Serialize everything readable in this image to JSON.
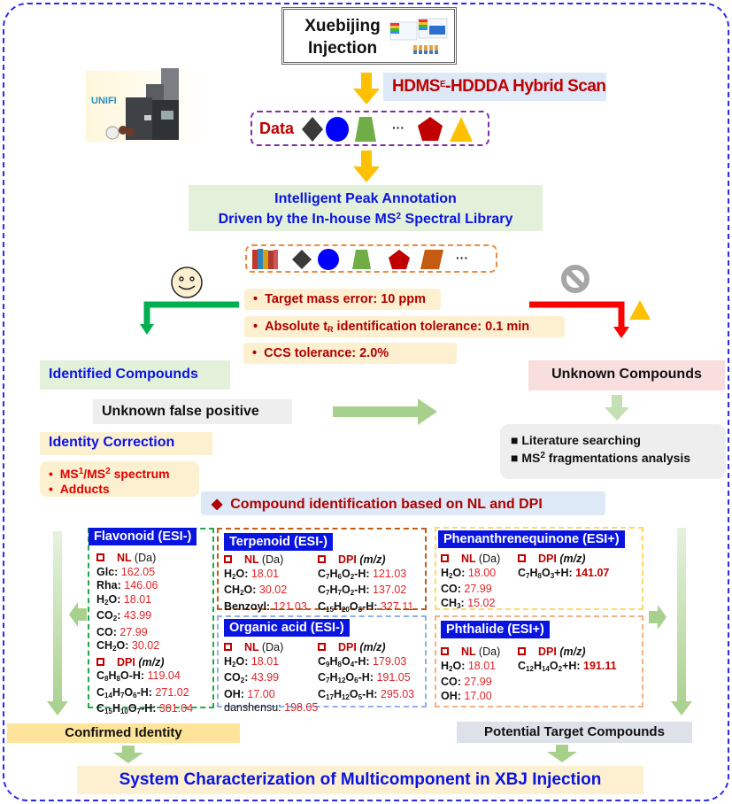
{
  "title": {
    "line1": "Xuebijing",
    "line2": "Injection",
    "image_icon": "xuebijing-package-image"
  },
  "instrument": {
    "logo_text": "UNIFI",
    "icon": "mass-spectrometer-image"
  },
  "scan": {
    "label_prefix": "HDMS",
    "label_sup": "E",
    "label_suffix": "-HDDDA Hybrid Scan"
  },
  "data_row": {
    "label": "Data",
    "ellipsis": "···",
    "shapes": [
      "diamond-dark",
      "circle-blue",
      "trapezoid-green",
      "pentagon-red",
      "triangle-yellow"
    ]
  },
  "annotation": {
    "line1": "Intelligent Peak Annotation",
    "line2_prefix": "Driven by the In-house MS",
    "line2_sup": "2",
    "line2_suffix": " Spectral Library"
  },
  "library_row": {
    "ellipsis": "···",
    "shapes": [
      "books",
      "diamond-dark",
      "circle-blue",
      "trapezoid-green",
      "pentagon-red",
      "parallelogram-orange"
    ]
  },
  "criteria": [
    {
      "bullet": "•",
      "text": "Target mass error: 10 ppm"
    },
    {
      "bullet": "•",
      "text_prefix": "Absolute t",
      "text_sub": "R",
      "text_suffix": " identification tolerance: 0.1 min"
    },
    {
      "bullet": "•",
      "text": "CCS tolerance: 2.0%"
    }
  ],
  "identified": {
    "label": "Identified Compounds",
    "status_icon": "smiley-icon"
  },
  "unknown": {
    "label": "Unknown Compounds",
    "status_icon": "no-entry-icon"
  },
  "unknown_false_positive": "Unknown false positive",
  "identity_correction": {
    "label": "Identity Correction",
    "items": [
      {
        "prefix": "MS",
        "sup1": "1",
        "mid": "/MS",
        "sup2": "2",
        "suffix": " spectrum"
      },
      {
        "text": "Adducts"
      }
    ]
  },
  "unknown_methods": [
    {
      "bullet": "■",
      "text": "Literature searching"
    },
    {
      "bullet": "■",
      "prefix": "MS",
      "sup": "2",
      "suffix": " fragmentations analysis"
    }
  ],
  "compound_id_header": {
    "bullet": "◆",
    "text": "Compound identification based on NL and DPI"
  },
  "nl_header": {
    "label": "NL",
    "unit": "(Da)"
  },
  "dpi_header": {
    "label": "DPI",
    "unit": "(m/z)"
  },
  "panels": {
    "flavonoid": {
      "title": "Flavonoid (ESI-)",
      "nl": [
        {
          "name": "Glc:",
          "value": "162.05"
        },
        {
          "name": "Rha:",
          "value": "146.06"
        },
        {
          "name": "H2O:",
          "value": "18.01"
        },
        {
          "name": "CO2:",
          "value": "43.99"
        },
        {
          "name": "CO:",
          "value": "27.99"
        },
        {
          "name": "CH2O:",
          "value": "30.02"
        }
      ],
      "dpi": [
        {
          "name": "C8H8O-H:",
          "value": "119.04"
        },
        {
          "name": "C14H7O6-H:",
          "value": "271.02"
        },
        {
          "name": "C15H10O7-H:",
          "value": "301.04"
        }
      ]
    },
    "terpenoid": {
      "title": "Terpenoid (ESI-)",
      "nl": [
        {
          "name": "H2O:",
          "value": "18.01"
        },
        {
          "name": "CH2O:",
          "value": "30.02"
        },
        {
          "name": "Benzoyl:",
          "value": "121.03"
        }
      ],
      "dpi": [
        {
          "name": "C7H6O2-H:",
          "value": "121.03"
        },
        {
          "name": "C7H7O2-H:",
          "value": "137.02"
        },
        {
          "name": "C15H20O8-H:",
          "value": "327.11"
        }
      ]
    },
    "organic_acid": {
      "title": "Organic acid (ESI-)",
      "nl": [
        {
          "name": "H2O:",
          "value": "18.01"
        },
        {
          "name": "CO2:",
          "value": "43.99"
        },
        {
          "name": "OH:",
          "value": "17.00"
        },
        {
          "name": "danshensu:",
          "value": "198.05"
        }
      ],
      "dpi": [
        {
          "name": "C9H8O4-H:",
          "value": "179.03"
        },
        {
          "name": "C7H12O6-H:",
          "value": "191.05"
        },
        {
          "name": "C17H12O5-H:",
          "value": "295.03"
        }
      ]
    },
    "phenanthrenequinone": {
      "title": "Phenanthrenequinone (ESI+)",
      "nl": [
        {
          "name": "H2O:",
          "value": "18.00"
        },
        {
          "name": "CO:",
          "value": "27.99"
        },
        {
          "name": "CH3:",
          "value": "15.02"
        }
      ],
      "dpi": [
        {
          "name": "C7H8O3+H:",
          "value": "141.07"
        }
      ]
    },
    "phthalide": {
      "title": "Phthalide (ESI+)",
      "nl": [
        {
          "name": "H2O:",
          "value": "18.01"
        },
        {
          "name": "CO:",
          "value": "27.99"
        },
        {
          "name": "OH:",
          "value": "17.00"
        }
      ],
      "dpi": [
        {
          "name": "C12H14O2+H:",
          "value": "191.11"
        }
      ]
    }
  },
  "confirmed_identity": "Confirmed Identity",
  "potential_targets": "Potential Target Compounds",
  "final": "System Characterization of Multicomponent in XBJ Injection",
  "colors": {
    "frame": "#2a2ae8",
    "title_blue": "#0a14e0",
    "dark_red": "#c00000",
    "value_red": "#e0242a",
    "yellow_arrow": "#ffc000",
    "green_arrow": "#a8d08d",
    "identified_green": "#00b050",
    "unknown_red": "#ff0000"
  }
}
